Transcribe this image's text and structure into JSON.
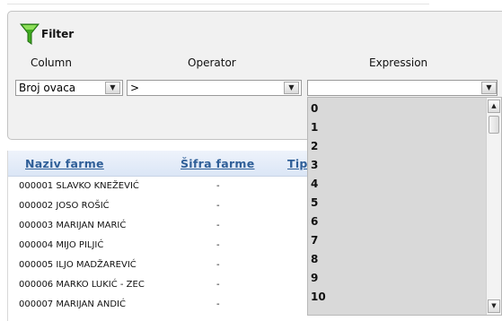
{
  "filter": {
    "title": "Filter",
    "columns": {
      "column": "Column",
      "operator": "Operator",
      "expression": "Expression"
    },
    "column_value": "Broj ovaca",
    "operator_value": ">",
    "expression_value": ""
  },
  "grid": {
    "headers": [
      "Naziv farme",
      "Šifra farme",
      "Tip"
    ],
    "rows": [
      {
        "naziv": "000001 SLAVKO KNEŽEVIĆ",
        "sifra": "-"
      },
      {
        "naziv": "000002 JOSO ROŠIĆ",
        "sifra": "-"
      },
      {
        "naziv": "000003 MARIJAN MARIĆ",
        "sifra": "-"
      },
      {
        "naziv": "000004 MIJO PILJIĆ",
        "sifra": "-"
      },
      {
        "naziv": "000005 ILJO MADŽAREVIĆ",
        "sifra": "-"
      },
      {
        "naziv": "000006 MARKO LUKIĆ - ZEC",
        "sifra": "-"
      },
      {
        "naziv": "000007 MARIJAN ANDIĆ",
        "sifra": "-"
      }
    ]
  },
  "dropdown": {
    "options": [
      "0",
      "1",
      "2",
      "3",
      "4",
      "5",
      "6",
      "7",
      "8",
      "9",
      "10"
    ]
  }
}
